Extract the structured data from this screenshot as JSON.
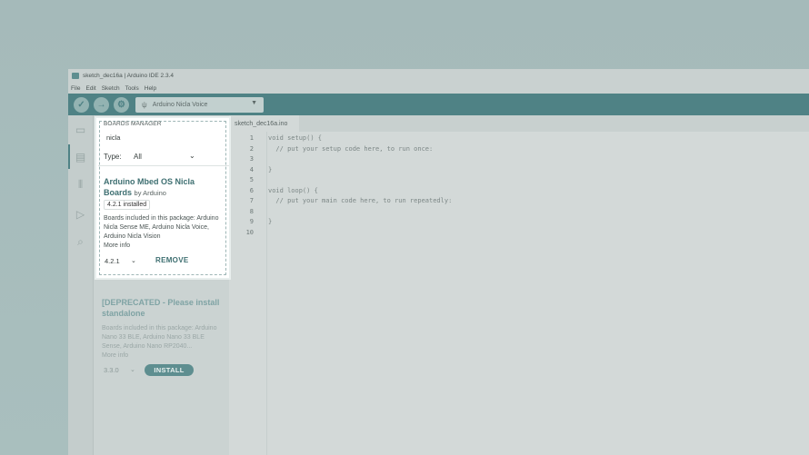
{
  "window": {
    "title": "sketch_dec16a | Arduino IDE 2.3.4"
  },
  "menu": [
    "File",
    "Edit",
    "Sketch",
    "Tools",
    "Help"
  ],
  "toolbar": {
    "verify_icon": "check-icon",
    "upload_icon": "arrow-right-icon",
    "debug_icon": "debug-icon",
    "board_selected": "Arduino Nicla Voice"
  },
  "sidebar": {
    "icons": [
      "folder-icon",
      "board-manager-icon",
      "library-icon",
      "debug-icon",
      "search-icon"
    ],
    "active": "board-manager-icon"
  },
  "editor": {
    "tab": "sketch_dec16a.ino",
    "lines": [
      {
        "n": "1",
        "code": "void setup() {"
      },
      {
        "n": "2",
        "code": "  // put your setup code here, to run once:"
      },
      {
        "n": "3",
        "code": ""
      },
      {
        "n": "4",
        "code": "}"
      },
      {
        "n": "5",
        "code": ""
      },
      {
        "n": "6",
        "code": "void loop() {"
      },
      {
        "n": "7",
        "code": "  // put your main code here, to run repeatedly:"
      },
      {
        "n": "8",
        "code": ""
      },
      {
        "n": "9",
        "code": "}"
      },
      {
        "n": "10",
        "code": ""
      }
    ]
  },
  "boards_manager": {
    "title": "BOARDS MANAGER",
    "search_value": "nicla",
    "type_label": "Type:",
    "type_value": "All",
    "entry": {
      "name": "Arduino Mbed OS Nicla Boards",
      "by": "by Arduino",
      "installed_badge": "4.2.1 installed",
      "description": "Boards included in this package: Arduino Nicla Sense ME, Arduino Nicla Voice, Arduino Nicla Vision",
      "more_info": "More info",
      "version": "4.2.1",
      "action": "REMOVE"
    },
    "deprecated_entry": {
      "name": "[DEPRECATED - Please install standalone",
      "description": "Boards included in this package: Arduino Nano 33 BLE, Arduino Nano 33 BLE Sense, Arduino Nano RP2040...",
      "more_info": "More info",
      "version": "3.3.0",
      "action": "INSTALL"
    }
  },
  "colors": {
    "toolbar": "#4f8285",
    "accent": "#3e6f71",
    "install_button": "#5e8e90"
  }
}
